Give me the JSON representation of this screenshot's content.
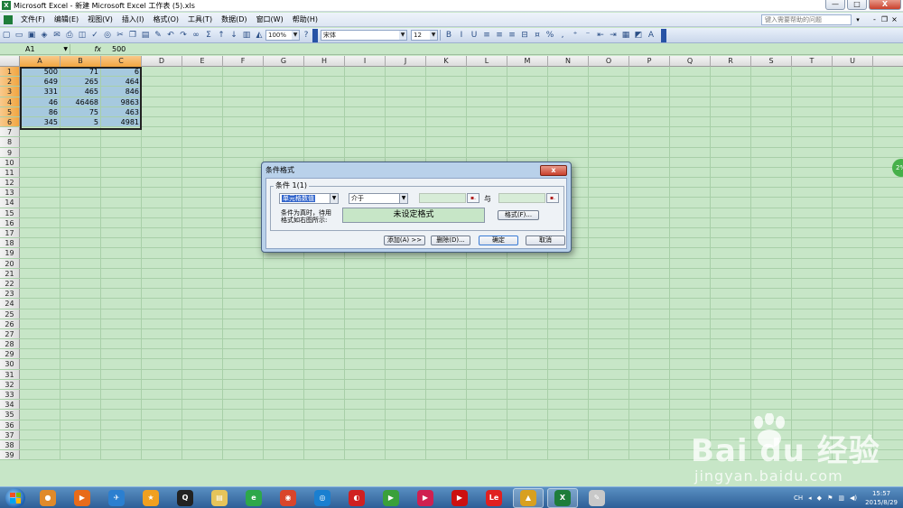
{
  "titlebar": {
    "title": "Microsoft Excel - 新建 Microsoft Excel 工作表 (5).xls",
    "minimize": "—",
    "maximize": "□",
    "close": "X"
  },
  "menu": {
    "items": [
      "文件(F)",
      "编辑(E)",
      "视图(V)",
      "插入(I)",
      "格式(O)",
      "工具(T)",
      "数据(D)",
      "窗口(W)",
      "帮助(H)"
    ],
    "help_placeholder": "键入需要帮助的问题",
    "help_arrow": "▾",
    "doc_controls": [
      "-",
      "❐",
      "×"
    ]
  },
  "toolbar": {
    "zoom": "100%",
    "font": "宋体",
    "font_size": "12",
    "icons": [
      "new-icon",
      "open-icon",
      "save-icon",
      "permission-icon",
      "email-icon",
      "print-icon",
      "print-preview-icon",
      "spelling-icon",
      "research-icon",
      "cut-icon",
      "copy-icon",
      "paste-icon",
      "format-painter-icon",
      "undo-icon",
      "redo-icon",
      "hyperlink-icon",
      "autosum-icon",
      "sort-ascending-icon",
      "sort-descending-icon",
      "chart-wizard-icon",
      "drawing-icon",
      "help-icon",
      "bold-icon",
      "italic-icon",
      "underline-icon",
      "align-left-icon",
      "center-icon",
      "align-right-icon",
      "merge-icon",
      "currency-icon",
      "percent-icon",
      "comma-icon",
      "increase-decimal-icon",
      "decrease-decimal-icon",
      "decrease-indent-icon",
      "increase-indent-icon",
      "borders-icon",
      "fill-color-icon",
      "font-color-icon"
    ],
    "glyphs": {
      "bold": "B",
      "italic": "I",
      "underline": "U",
      "percent": "%",
      "comma": ",",
      "autosum": "Σ",
      "font_color": "A"
    }
  },
  "formula": {
    "cell_ref": "A1",
    "fx": "fx",
    "value": "500"
  },
  "columns": [
    "A",
    "B",
    "C",
    "D",
    "E",
    "F",
    "G",
    "H",
    "I",
    "J",
    "K",
    "L",
    "M",
    "N",
    "O",
    "P",
    "Q",
    "R",
    "S",
    "T",
    "U"
  ],
  "row_count": 39,
  "data": [
    [
      "500",
      "71",
      "6"
    ],
    [
      "649",
      "265",
      "464"
    ],
    [
      "331",
      "465",
      "846"
    ],
    [
      "46",
      "46468",
      "9863"
    ],
    [
      "86",
      "75",
      "463"
    ],
    [
      "345",
      "5",
      "4981"
    ]
  ],
  "dialog": {
    "title": "条件格式",
    "close_label": "x",
    "condition_label": "条件 1(1)",
    "condition_type": "单元格数值",
    "operator": "介于",
    "and_label": "与",
    "pick_icon_text": "▪.",
    "preview_text_line1": "条件为真时，待用",
    "preview_text_line2": "格式如右图所示:",
    "preview": "未设定格式",
    "format_button": "格式(F)...",
    "add_button": "添加(A) >>",
    "delete_button": "删除(D)...",
    "ok_button": "确定",
    "cancel_button": "取消"
  },
  "side_bubble": "2%",
  "watermark": {
    "brand": "Bai du 经验",
    "url": "jingyan.baidu.com"
  },
  "taskbar": {
    "apps": [
      {
        "name": "orb-app-icon",
        "color": "#e08a2a",
        "glyph": "●"
      },
      {
        "name": "media-player-icon",
        "color": "#e86b1a",
        "glyph": "▶"
      },
      {
        "name": "bird-icon",
        "color": "#2b7fd0",
        "glyph": "✈"
      },
      {
        "name": "star-app-icon",
        "color": "#f0a020",
        "glyph": "★"
      },
      {
        "name": "qq-icon",
        "color": "#222",
        "glyph": "Q"
      },
      {
        "name": "folder-icon",
        "color": "#e6c45a",
        "glyph": "▤"
      },
      {
        "name": "ie-icon",
        "color": "#2da84a",
        "glyph": "e"
      },
      {
        "name": "chrome-icon",
        "color": "#d9452b",
        "glyph": "◉"
      },
      {
        "name": "app-blue-icon",
        "color": "#1a7fd0",
        "glyph": "◎"
      },
      {
        "name": "app-red-icon",
        "color": "#d02020",
        "glyph": "◐"
      },
      {
        "name": "app-green-play-icon",
        "color": "#3aa03a",
        "glyph": "▶"
      },
      {
        "name": "app-play-circle-icon",
        "color": "#d02050",
        "glyph": "▶"
      },
      {
        "name": "app-red-play-icon",
        "color": "#cc1010",
        "glyph": "▶"
      },
      {
        "name": "letv-icon",
        "color": "#e02020",
        "glyph": "Le"
      },
      {
        "name": "app-yellow-icon",
        "color": "#d8a020",
        "glyph": "▲"
      },
      {
        "name": "excel-icon",
        "color": "#1e7d3a",
        "glyph": "X"
      },
      {
        "name": "paint-icon",
        "color": "#c8c8c8",
        "glyph": "✎"
      }
    ],
    "tray_lang": "CH",
    "time": "15:57",
    "date": "2015/8/29"
  }
}
